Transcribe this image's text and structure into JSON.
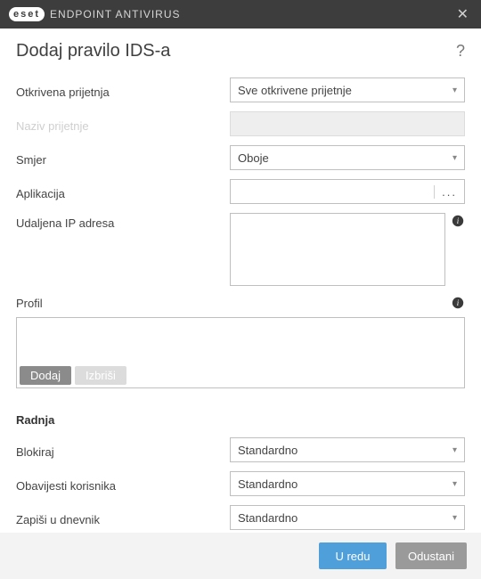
{
  "titlebar": {
    "brand_logo": "eset",
    "app_name": "ENDPOINT ANTIVIRUS"
  },
  "heading": "Dodaj pravilo IDS-a",
  "help_symbol": "?",
  "form": {
    "threat": {
      "label": "Otkrivena prijetnja",
      "value": "Sve otkrivene prijetnje"
    },
    "threat_name": {
      "label": "Naziv prijetnje",
      "value": ""
    },
    "direction": {
      "label": "Smjer",
      "value": "Oboje"
    },
    "application": {
      "label": "Aplikacija",
      "value": "",
      "browse": "..."
    },
    "remote_ip": {
      "label": "Udaljena IP adresa",
      "value": ""
    }
  },
  "profile": {
    "label": "Profil",
    "add": "Dodaj",
    "delete": "Izbriši"
  },
  "action": {
    "section_title": "Radnja",
    "block": {
      "label": "Blokiraj",
      "value": "Standardno"
    },
    "notify": {
      "label": "Obavijesti korisnika",
      "value": "Standardno"
    },
    "log": {
      "label": "Zapiši u dnevnik",
      "value": "Standardno"
    }
  },
  "footer": {
    "ok": "U redu",
    "cancel": "Odustani"
  }
}
